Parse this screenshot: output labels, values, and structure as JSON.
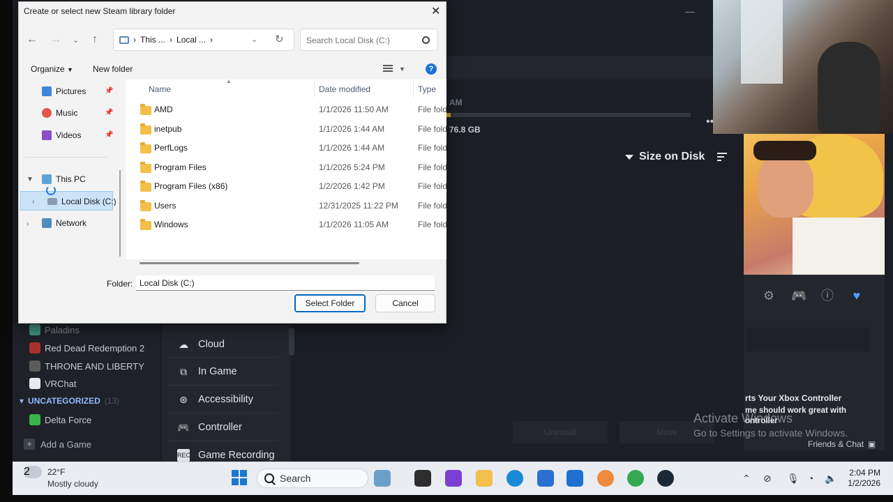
{
  "dialog": {
    "title": "Create or select new Steam library folder",
    "breadcrumb": [
      "This ...",
      "Local ..."
    ],
    "search_placeholder": "Search Local Disk (C:)",
    "toolbar": {
      "organize": "Organize",
      "new_folder": "New folder"
    },
    "nav_pane": {
      "quick_access": [
        {
          "label": "Pictures",
          "icon": "pictures-icon",
          "color": "#3f86d8"
        },
        {
          "label": "Music",
          "icon": "music-icon",
          "color": "#e2574c"
        },
        {
          "label": "Videos",
          "icon": "videos-icon",
          "color": "#8a4fc7"
        }
      ],
      "this_pc": "This PC",
      "selected_drive": "Local Disk (C:)",
      "network": "Network"
    },
    "columns": {
      "name": "Name",
      "date": "Date modified",
      "type": "Type"
    },
    "files": [
      {
        "name": "AMD",
        "date": "1/1/2026 11:50 AM",
        "type": "File folder"
      },
      {
        "name": "inetpub",
        "date": "1/1/2026 1:44 AM",
        "type": "File folder"
      },
      {
        "name": "PerfLogs",
        "date": "1/1/2026 1:44 AM",
        "type": "File folder"
      },
      {
        "name": "Program Files",
        "date": "1/1/2026 5:24 PM",
        "type": "File folder"
      },
      {
        "name": "Program Files (x86)",
        "date": "1/2/2026 1:42 PM",
        "type": "File folder"
      },
      {
        "name": "Users",
        "date": "12/31/2025 11:22 PM",
        "type": "File folder"
      },
      {
        "name": "Windows",
        "date": "1/1/2026 11:05 AM",
        "type": "File folder"
      }
    ],
    "folder_label": "Folder:",
    "folder_value": "Local Disk (C:)",
    "select_button": "Select Folder",
    "cancel_button": "Cancel"
  },
  "steam": {
    "storage": {
      "am_label": "AM",
      "used_label": "76.8 GB",
      "sort_label": "Size on Disk"
    },
    "library": {
      "games": [
        {
          "name": "Paladins",
          "color": "#3e8f7a"
        },
        {
          "name": "Red Dead Redemption 2",
          "color": "#a8322b"
        },
        {
          "name": "THRONE AND LIBERTY",
          "color": "#5b5b5b"
        },
        {
          "name": "VRChat",
          "color": "#e8eaee"
        }
      ],
      "category": "UNCATEGORIZED",
      "category_count": "(13)",
      "uncategorized_games": [
        {
          "name": "Delta Force",
          "color": "#37b34a"
        }
      ],
      "add_game": "Add a Game"
    },
    "settings_menu": [
      {
        "label": "Cloud",
        "icon": "cloud-icon"
      },
      {
        "label": "In Game",
        "icon": "in-game-icon"
      },
      {
        "label": "Accessibility",
        "icon": "accessibility-icon"
      },
      {
        "label": "Controller",
        "icon": "controller-icon"
      },
      {
        "label": "Game Recording",
        "icon": "rec-icon"
      }
    ],
    "right_panel": {
      "xbox_title": "rts Your Xbox Controller",
      "xbox_desc": "me should work great with ontroller"
    },
    "buttons": {
      "uninstall": "Uninstall",
      "move": "Move"
    },
    "friends_chat": "Friends & Chat"
  },
  "windows": {
    "activate_title": "Activate Windows",
    "activate_desc": "Go to Settings to activate Windows."
  },
  "taskbar": {
    "weather_badge": "2",
    "temperature": "22°F",
    "weather_desc": "Mostly cloudy",
    "search_label": "Search",
    "time": "2:04 PM",
    "date": "1/2/2026",
    "apps": [
      {
        "name": "widgets-app-icon",
        "color": "#6aa0c8"
      },
      {
        "name": "terminal-app-icon",
        "color": "#2d2d2d"
      },
      {
        "name": "pcgamepass-app-icon",
        "color": "#7b3fd1"
      },
      {
        "name": "file-explorer-icon",
        "color": "#f2c04b"
      },
      {
        "name": "edge-icon",
        "color": "#1a8ad6"
      },
      {
        "name": "store-icon",
        "color": "#2a6fd1"
      },
      {
        "name": "outlook-icon",
        "color": "#1d6fd0"
      },
      {
        "name": "copilot-icon",
        "color": "#f08a3c"
      },
      {
        "name": "chrome-icon",
        "color": "#34a853"
      },
      {
        "name": "steam-icon",
        "color": "#1b2838"
      }
    ]
  }
}
